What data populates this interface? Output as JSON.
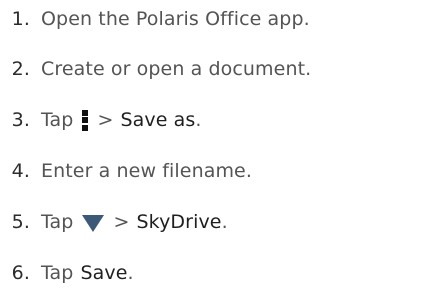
{
  "steps": [
    {
      "number": "1.",
      "text": "Open the Polaris Office app."
    },
    {
      "number": "2.",
      "text": "Create or open a document."
    },
    {
      "number": "3.",
      "before": "Tap",
      "icon": "more-vertical-icon",
      "sep": ">",
      "ui_label": "Save as",
      "after": "."
    },
    {
      "number": "4.",
      "text": "Enter a new filename."
    },
    {
      "number": "5.",
      "before": "Tap",
      "icon": "dropdown-triangle-icon",
      "sep": ">",
      "ui_label": "SkyDrive",
      "after": "."
    },
    {
      "number": "6.",
      "before": "Tap",
      "ui_label": "Save",
      "after": "."
    }
  ],
  "colors": {
    "text": "#545454",
    "ui_label": "#1f1f1f",
    "triangle_icon": "#3c5a78",
    "menu_icon": "#111111"
  }
}
